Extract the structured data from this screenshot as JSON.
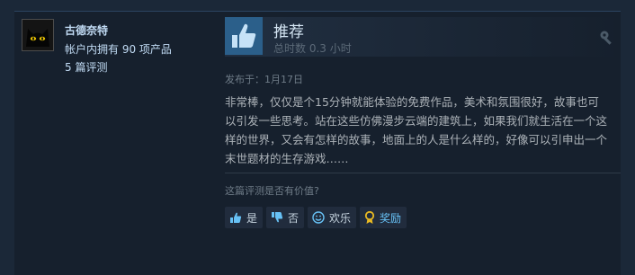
{
  "reviewer": {
    "name": "古德奈特",
    "games_owned": "帐户内拥有 90 项产品",
    "reviews_count": "5 篇评测",
    "avatar_icon": "black-cat-avatar-icon"
  },
  "review": {
    "recommendation": "推荐",
    "playtime": "总时数 0.3 小时",
    "posted": "发布于：1月17日",
    "text": "非常棒，仅仅是个15分钟就能体验的免费作品，美术和氛围很好，故事也可以引发一些思考。站在这些仿佛漫步云端的建筑上，如果我们就生活在一个这样的世界，又会有怎样的故事，地面上的人是什么样的，好像可以引申出一个末世题材的生存游戏……",
    "thumb_icon": "thumbs-up-icon",
    "settings_icon": "settings-icon"
  },
  "helpful": {
    "question": "这篇评测是否有价值?",
    "buttons": {
      "yes": "是",
      "no": "否",
      "funny": "欢乐",
      "award": "奖励"
    }
  },
  "colors": {
    "background": "#1b2838",
    "panel": "#16202d",
    "accent": "#67c1f5",
    "thumb_bg": "#2b5f8a"
  }
}
